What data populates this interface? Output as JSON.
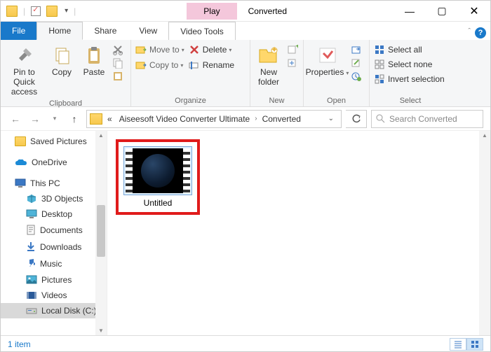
{
  "title": {
    "play": "Play",
    "name": "Converted"
  },
  "tabs": {
    "file": "File",
    "home": "Home",
    "share": "Share",
    "view": "View",
    "video_tools": "Video Tools"
  },
  "ribbon": {
    "clipboard": {
      "label": "Clipboard",
      "pin": "Pin to Quick\naccess",
      "copy": "Copy",
      "paste": "Paste"
    },
    "organize": {
      "label": "Organize",
      "move_to": "Move to",
      "copy_to": "Copy to",
      "delete": "Delete",
      "rename": "Rename"
    },
    "new": {
      "label": "New",
      "new_folder": "New\nfolder"
    },
    "open": {
      "label": "Open",
      "properties": "Properties"
    },
    "select": {
      "label": "Select",
      "all": "Select all",
      "none": "Select none",
      "invert": "Invert selection"
    }
  },
  "address": {
    "prefix": "«",
    "seg1": "Aiseesoft Video Converter Ultimate",
    "seg2": "Converted"
  },
  "search": {
    "placeholder": "Search Converted"
  },
  "sidebar": {
    "items": [
      {
        "label": "Saved Pictures"
      },
      {
        "label": "OneDrive"
      },
      {
        "label": "This PC"
      },
      {
        "label": "3D Objects"
      },
      {
        "label": "Desktop"
      },
      {
        "label": "Documents"
      },
      {
        "label": "Downloads"
      },
      {
        "label": "Music"
      },
      {
        "label": "Pictures"
      },
      {
        "label": "Videos"
      },
      {
        "label": "Local Disk (C:)"
      }
    ]
  },
  "file": {
    "name": "Untitled"
  },
  "status": {
    "text": "1 item"
  }
}
